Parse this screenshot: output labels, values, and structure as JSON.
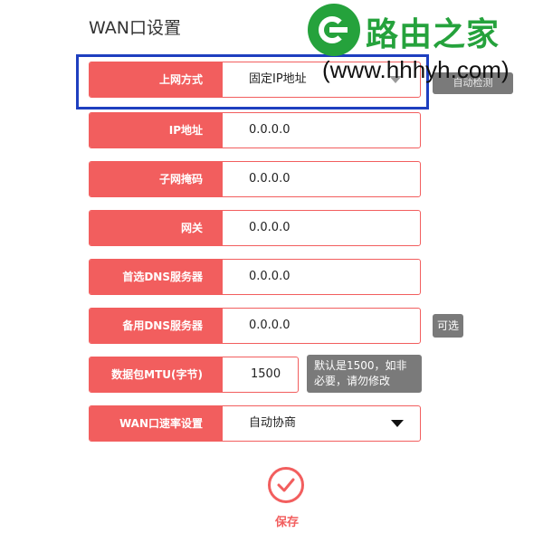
{
  "page": {
    "title": "WAN口设置"
  },
  "watermark": {
    "name": "路由之家",
    "url": "(www.hhhyh.com)",
    "logo_icon": "brand-e-logo-icon"
  },
  "form": {
    "rows": [
      {
        "label": "上网方式",
        "value": "固定IP地址"
      },
      {
        "label": "IP地址",
        "value": "0.0.0.0"
      },
      {
        "label": "子网掩码",
        "value": "0.0.0.0"
      },
      {
        "label": "网关",
        "value": "0.0.0.0"
      },
      {
        "label": "首选DNS服务器",
        "value": "0.0.0.0"
      },
      {
        "label": "备用DNS服务器",
        "value": "0.0.0.0"
      },
      {
        "label": "数据包MTU(字节)",
        "value": "1500"
      },
      {
        "label": "WAN口速率设置",
        "value": "自动协商"
      }
    ],
    "auto_detect_label": "自动检测",
    "optional_tip": "可选",
    "mtu_tip": "默认是1500，如非必要，请勿修改"
  },
  "save": {
    "label": "保存",
    "icon": "checkmark-icon"
  },
  "colors": {
    "accent": "#f25e5e",
    "tip_bg": "#7a7a7a",
    "highlight": "#1e3fbf",
    "watermark": "#25a23c"
  }
}
